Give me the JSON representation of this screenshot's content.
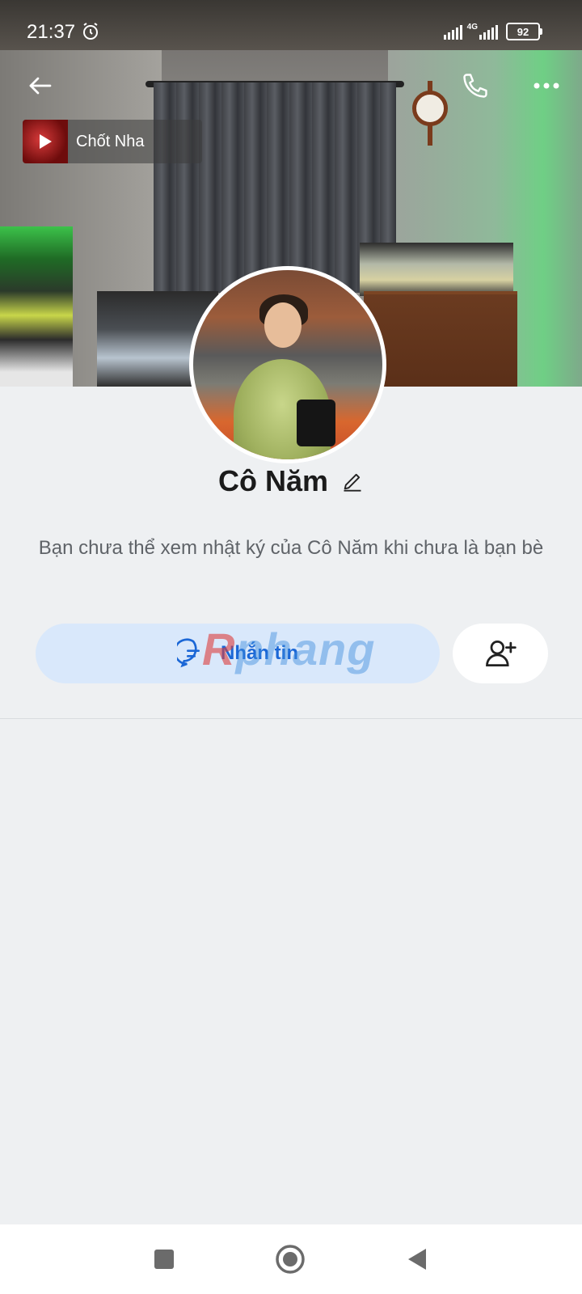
{
  "status_bar": {
    "time": "21:37",
    "network": "4G",
    "battery": "92"
  },
  "music": {
    "title": "Chốt Nha"
  },
  "profile": {
    "name": "Cô Năm",
    "notice": "Bạn chưa thể xem nhật ký của Cô Năm khi chưa là bạn bè"
  },
  "actions": {
    "message_label": "Nhắn tin"
  },
  "watermark": {
    "part1": "R",
    "part2": "phang"
  },
  "icons": {
    "back": "arrow-left-icon",
    "call": "phone-icon",
    "more": "more-horizontal-icon",
    "play": "play-icon",
    "edit": "pencil-icon",
    "message": "chat-bubble-icon",
    "add_friend": "user-plus-icon",
    "alarm": "alarm-clock-icon"
  },
  "colors": {
    "accent": "#1b67d6",
    "message_button_bg": "#d9e8fb",
    "page_bg": "#eef0f2"
  }
}
